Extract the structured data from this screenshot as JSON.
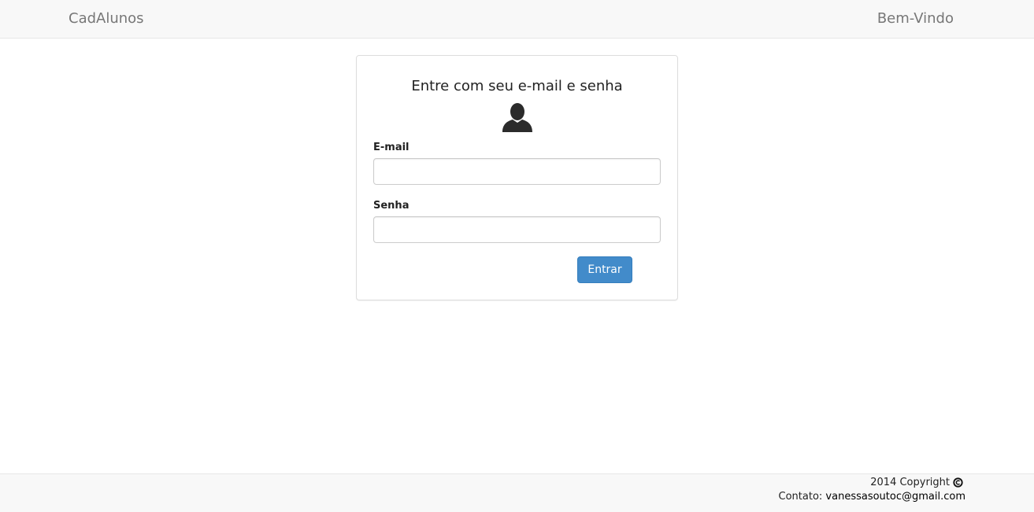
{
  "navbar": {
    "brand": "CadAlunos",
    "welcome": "Bem-Vindo"
  },
  "login": {
    "title": "Entre com seu e-mail e senha",
    "avatar_icon": "user-silhouette-icon",
    "email_label": "E-mail",
    "email_value": "",
    "email_placeholder": "",
    "password_label": "Senha",
    "password_value": "",
    "password_placeholder": "",
    "submit_label": "Entrar"
  },
  "footer": {
    "copyright": "2014 Copyright",
    "copyright_icon": "copyright-icon",
    "contact_label": "Contato:",
    "contact_email": "vanessasoutoc@gmail.com"
  },
  "colors": {
    "navbar_bg": "#f8f8f8",
    "primary_button": "#428bca",
    "muted_text": "#777777"
  }
}
